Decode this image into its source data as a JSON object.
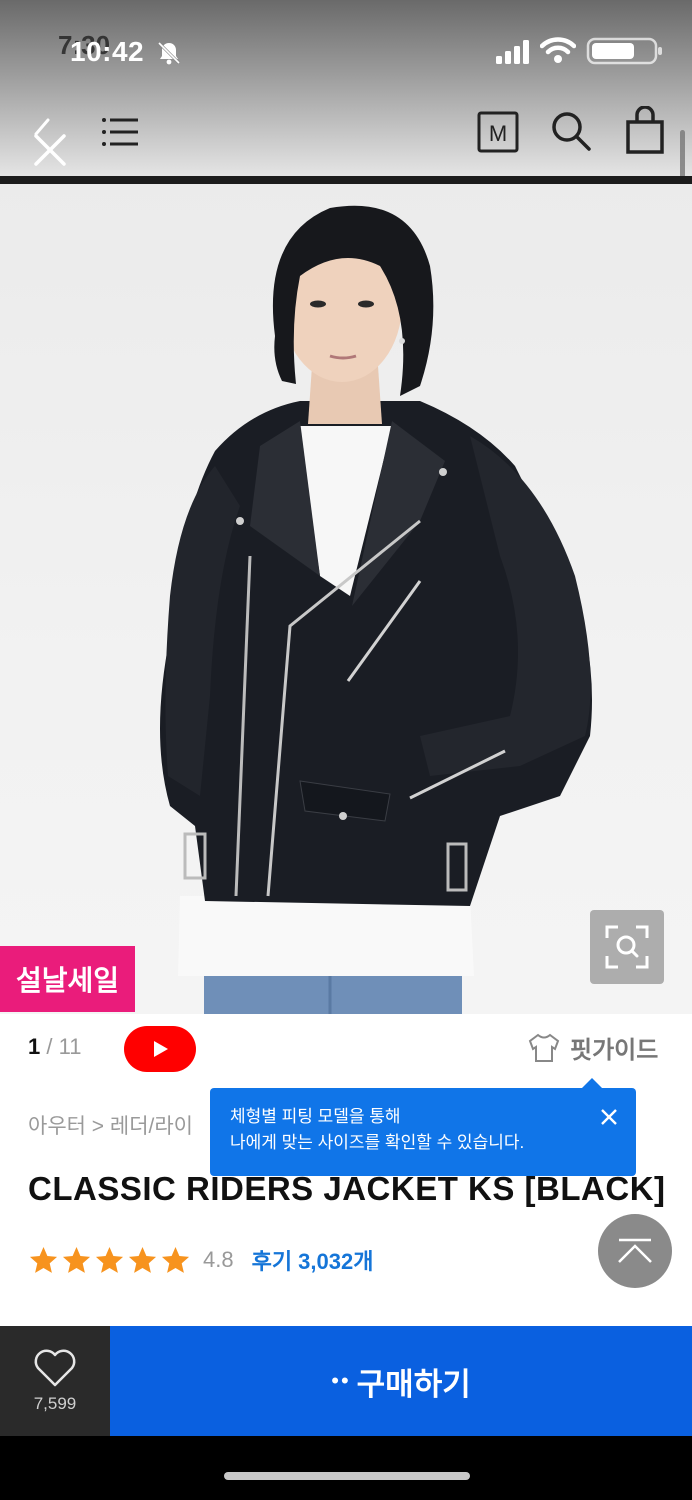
{
  "status_bar": {
    "time_overlay": "7:30",
    "time": "10:42",
    "icons": [
      "bell-off-icon",
      "signal-icon",
      "wifi-icon",
      "battery-icon"
    ]
  },
  "header": {
    "icons": [
      "back-icon",
      "close-icon",
      "menu-icon",
      "brand-m-icon",
      "search-icon",
      "shopping-bag-icon"
    ],
    "brand_letter": "M"
  },
  "hero": {
    "image_alt": "photo",
    "zoom_icon": "zoom-icon",
    "sale_badge": "설날세일"
  },
  "gallery": {
    "current": "1",
    "separator": "/",
    "total": "11",
    "youtube_icon": "play-icon"
  },
  "fit_guide": {
    "label": "핏가이드",
    "icon": "shirt-icon"
  },
  "tooltip": {
    "line1": "체형별 피팅 모델을 통해",
    "line2": "나에게 맞는 사이즈를 확인할 수 있습니다.",
    "close_icon": "close-icon"
  },
  "product": {
    "breadcrumb": "아우터 > 레더/라이",
    "title": "CLASSIC RIDERS JACKET KS [BLACK]",
    "rating": "4.8",
    "rating_value": 4.8,
    "rating_max": 5,
    "reviews": "후기 3,032개"
  },
  "scroll_top_icon": "arrow-up-icon",
  "bottom_bar": {
    "like_icon": "heart-icon",
    "like_count": "7,599",
    "buy_prefix": "••",
    "buy_label": "구매하기"
  },
  "colors": {
    "sale_pink": "#ea1c7b",
    "tooltip_blue": "#1075e8",
    "buy_blue": "#0a60e0",
    "star_orange": "#f7931e",
    "review_blue": "#1575d8",
    "youtube_red": "#ff0000"
  }
}
